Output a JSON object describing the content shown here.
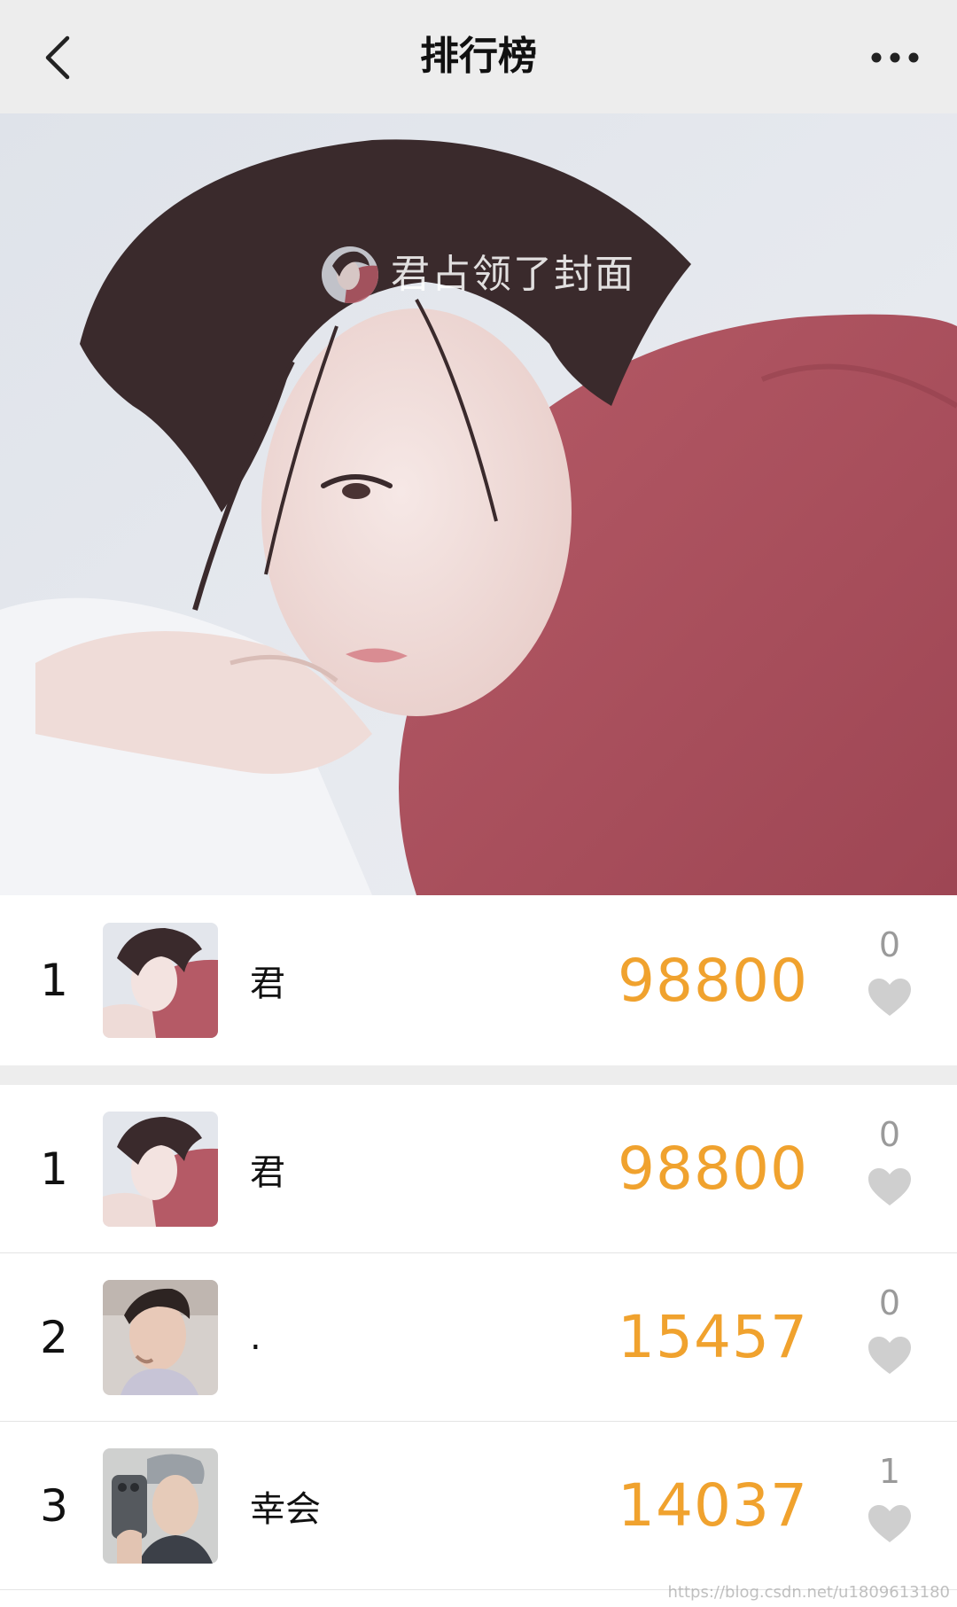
{
  "navbar": {
    "title": "排行榜",
    "back_icon": "chevron-left-icon",
    "more_icon": "more-dots-icon"
  },
  "cover": {
    "caption": "君占领了封面"
  },
  "my_rank": {
    "rank": "1",
    "name": "君",
    "score": "98800",
    "likes": "0"
  },
  "ranking": [
    {
      "rank": "1",
      "name": "君",
      "score": "98800",
      "likes": "0"
    },
    {
      "rank": "2",
      "name": ".",
      "score": "15457",
      "likes": "0"
    },
    {
      "rank": "3",
      "name": "幸会",
      "score": "14037",
      "likes": "1"
    }
  ],
  "watermark": "https://blog.csdn.net/u1809613180",
  "colors": {
    "score": "#f0a22e",
    "heart": "#cfcfcf",
    "navbar_bg": "#ededed"
  }
}
